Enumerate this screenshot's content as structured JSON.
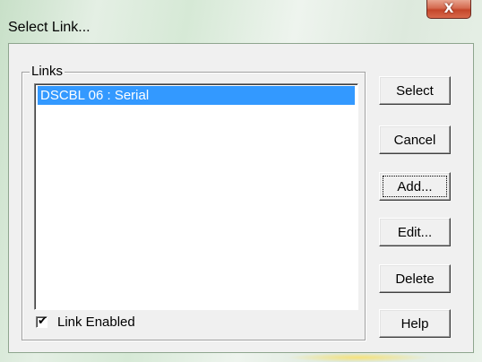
{
  "window": {
    "title": "Select Link...",
    "close_glyph": "X"
  },
  "links_group": {
    "label": "Links",
    "items": [
      {
        "label": "DSCBL 06 : Serial",
        "selected": true
      }
    ]
  },
  "link_enabled": {
    "label": "Link Enabled",
    "checked": true,
    "check_glyph": "✔"
  },
  "buttons": {
    "select": "Select",
    "cancel": "Cancel",
    "add": "Add...",
    "edit": "Edit...",
    "delete": "Delete",
    "help": "Help"
  },
  "colors": {
    "selection": "#3399ff",
    "close_button": "#c4462a",
    "dialog_face": "#f0f0f0"
  },
  "icons": {
    "close": "close-icon",
    "checkmark": "checkmark-icon"
  }
}
